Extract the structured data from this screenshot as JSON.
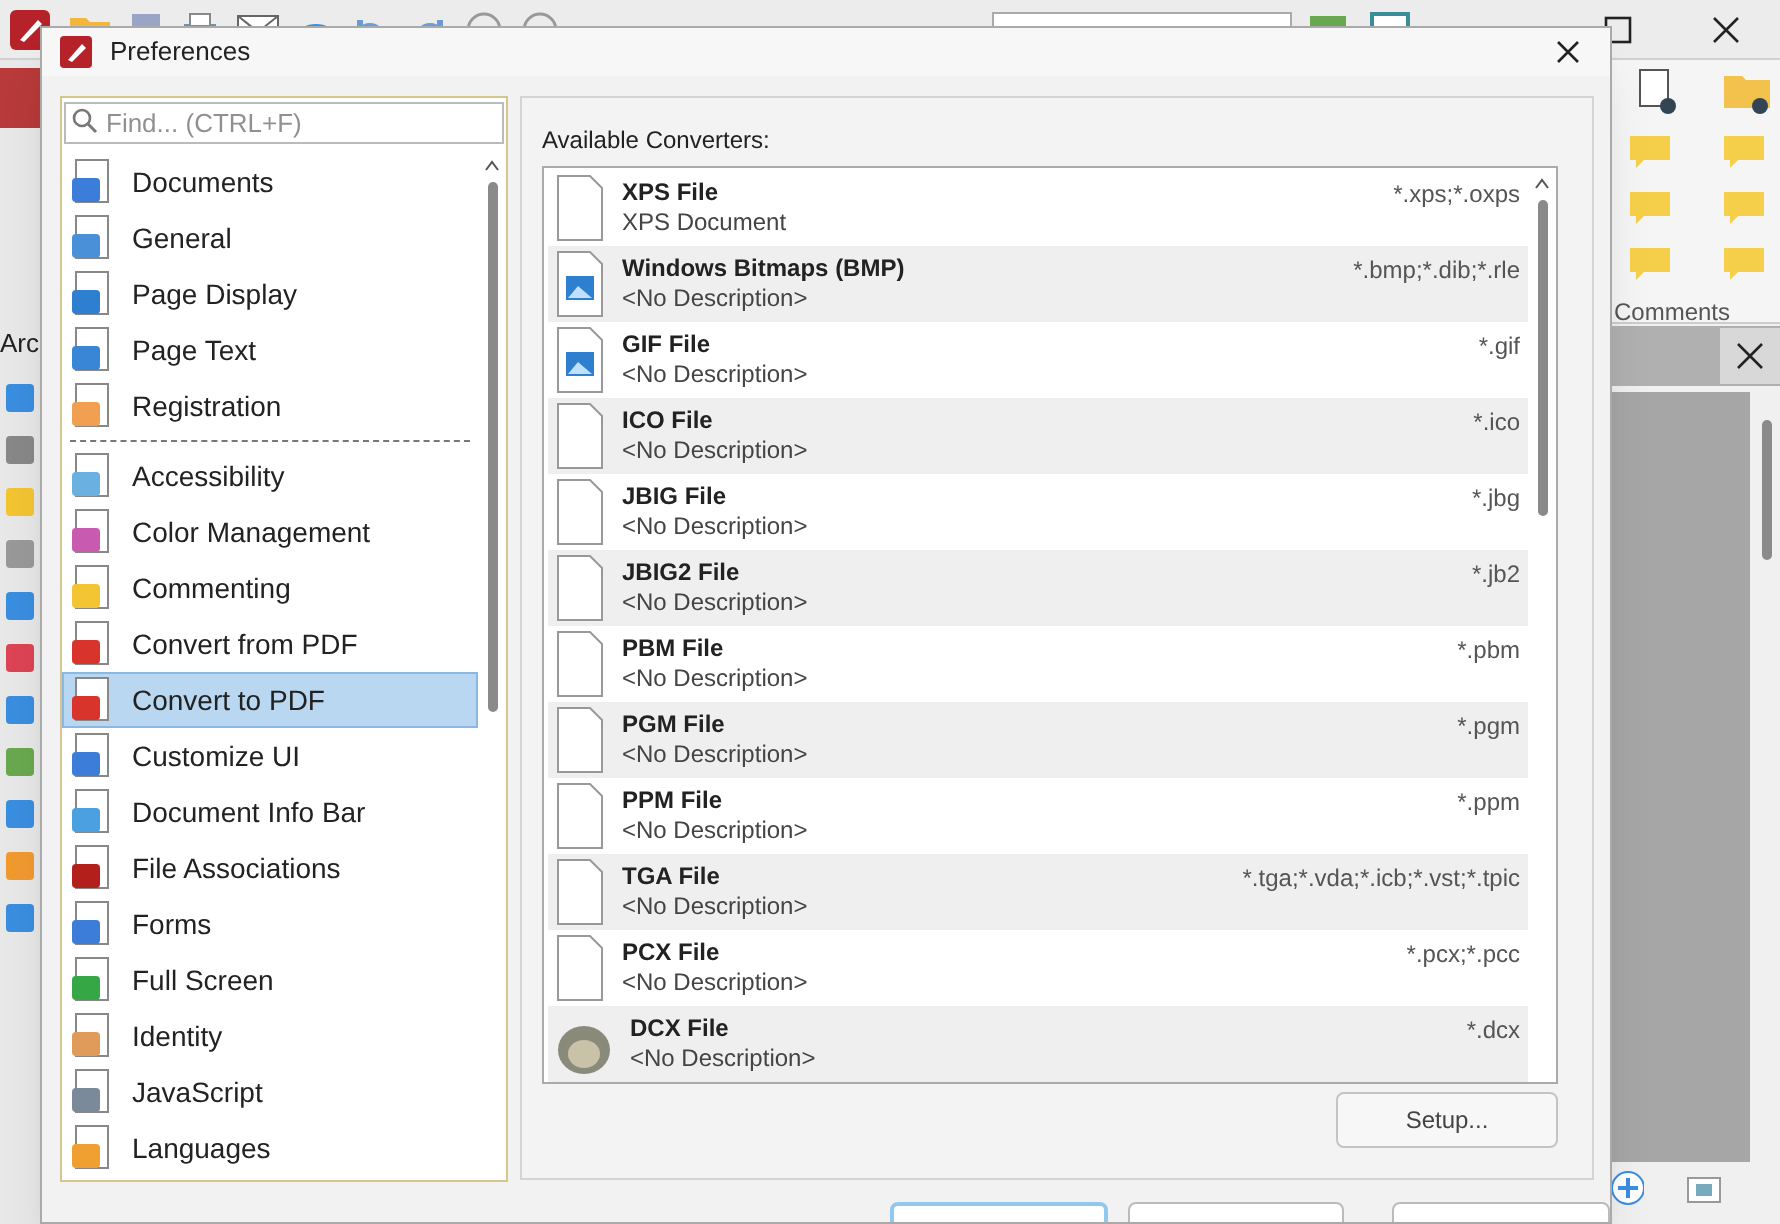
{
  "app": {
    "tab_label": "Arc",
    "ribbon_group": "Comments"
  },
  "dialog": {
    "title": "Preferences",
    "search": {
      "placeholder": "Find... (CTRL+F)"
    },
    "categories": [
      {
        "label": "Documents",
        "selected": false
      },
      {
        "label": "General",
        "selected": false
      },
      {
        "label": "Page Display",
        "selected": false
      },
      {
        "label": "Page Text",
        "selected": false
      },
      {
        "label": "Registration",
        "selected": false,
        "separator_after": true
      },
      {
        "label": "Accessibility",
        "selected": false
      },
      {
        "label": "Color Management",
        "selected": false
      },
      {
        "label": "Commenting",
        "selected": false
      },
      {
        "label": "Convert from PDF",
        "selected": false
      },
      {
        "label": "Convert to PDF",
        "selected": true
      },
      {
        "label": "Customize UI",
        "selected": false
      },
      {
        "label": "Document Info Bar",
        "selected": false
      },
      {
        "label": "File Associations",
        "selected": false
      },
      {
        "label": "Forms",
        "selected": false
      },
      {
        "label": "Full Screen",
        "selected": false
      },
      {
        "label": "Identity",
        "selected": false
      },
      {
        "label": "JavaScript",
        "selected": false
      },
      {
        "label": "Languages",
        "selected": false
      }
    ],
    "converters_label": "Available Converters:",
    "converters": [
      {
        "kind": "page",
        "name": "XPS File",
        "description": "XPS Document",
        "extensions": "*.xps;*.oxps"
      },
      {
        "kind": "image",
        "name": "Windows Bitmaps (BMP)",
        "description": "<No Description>",
        "extensions": "*.bmp;*.dib;*.rle"
      },
      {
        "kind": "image",
        "name": "GIF File",
        "description": "<No Description>",
        "extensions": "*.gif"
      },
      {
        "kind": "page",
        "name": "ICO File",
        "description": "<No Description>",
        "extensions": "*.ico"
      },
      {
        "kind": "page",
        "name": "JBIG File",
        "description": "<No Description>",
        "extensions": "*.jbg"
      },
      {
        "kind": "page",
        "name": "JBIG2 File",
        "description": "<No Description>",
        "extensions": "*.jb2"
      },
      {
        "kind": "page",
        "name": "PBM File",
        "description": "<No Description>",
        "extensions": "*.pbm"
      },
      {
        "kind": "page",
        "name": "PGM File",
        "description": "<No Description>",
        "extensions": "*.pgm"
      },
      {
        "kind": "page",
        "name": "PPM File",
        "description": "<No Description>",
        "extensions": "*.ppm"
      },
      {
        "kind": "page",
        "name": "TGA File",
        "description": "<No Description>",
        "extensions": "*.tga;*.vda;*.icb;*.vst;*.tpic"
      },
      {
        "kind": "page",
        "name": "PCX File",
        "description": "<No Description>",
        "extensions": "*.pcx;*.pcc"
      },
      {
        "kind": "app",
        "name": "DCX File",
        "description": "<No Description>",
        "extensions": "*.dcx"
      }
    ],
    "setup_button": "Setup..."
  }
}
